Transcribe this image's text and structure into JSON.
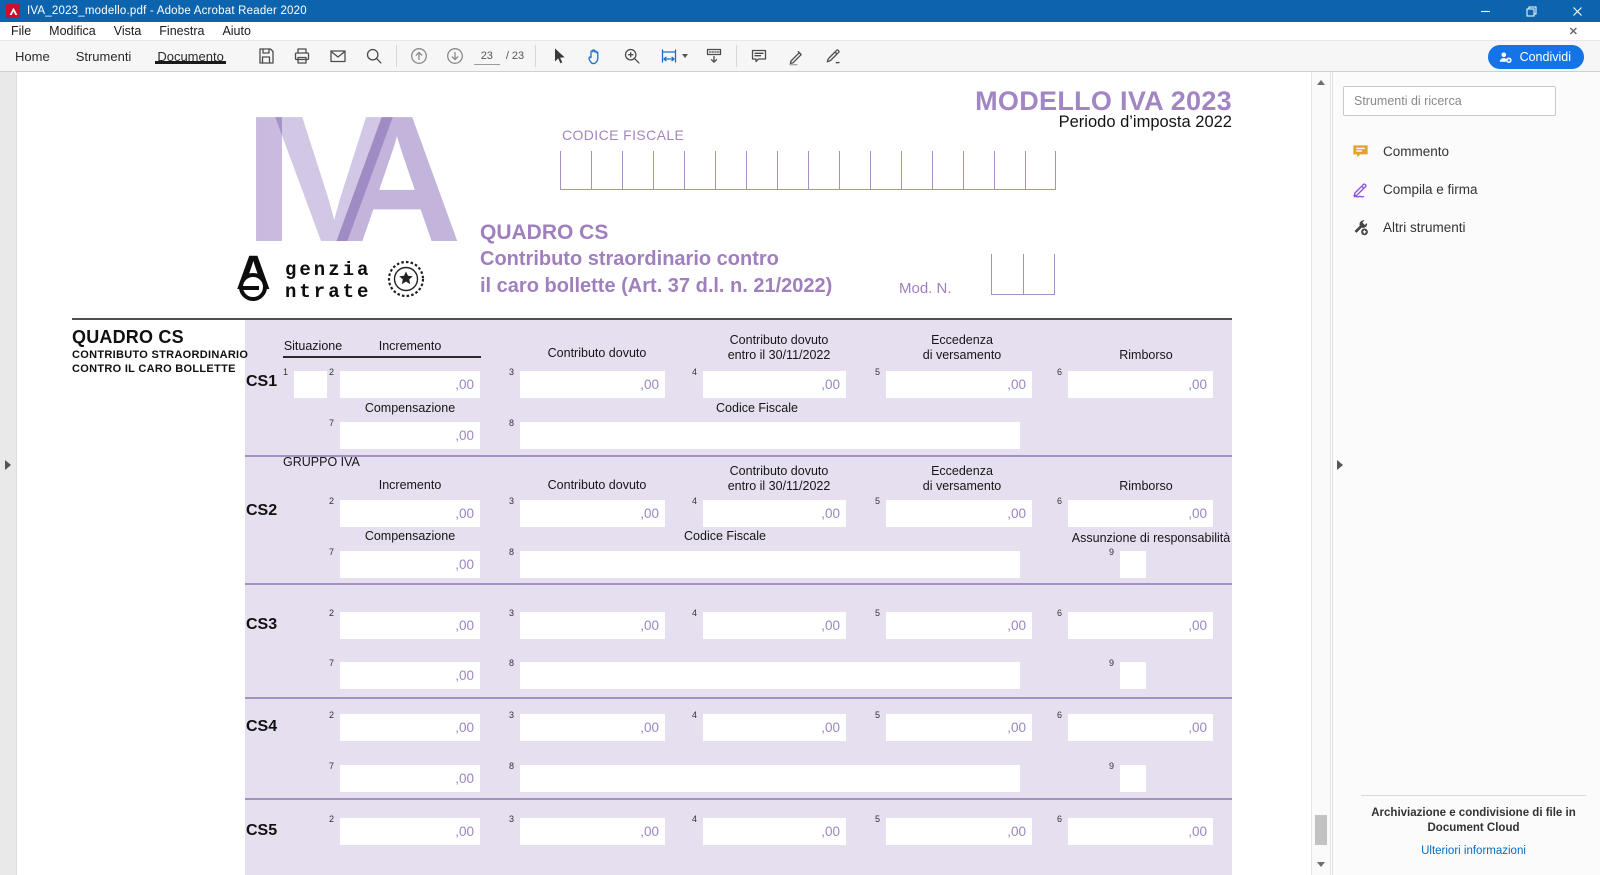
{
  "window": {
    "title": "IVA_2023_modello.pdf - Adobe Acrobat Reader 2020",
    "controls": {
      "minimize": "–",
      "restore": "restore",
      "close": "✕"
    }
  },
  "menu": {
    "items": [
      "File",
      "Modifica",
      "Vista",
      "Finestra",
      "Aiuto"
    ],
    "close_glyph": "✕"
  },
  "toolbar": {
    "tabs": [
      {
        "label": "Home"
      },
      {
        "label": "Strumenti"
      },
      {
        "label": "Documento"
      }
    ],
    "icons": [
      "save",
      "print",
      "email",
      "search",
      "page-up",
      "page-down",
      "select",
      "hand",
      "zoom-in",
      "fit-width",
      "page-display",
      "comment",
      "highlight",
      "fill-sign"
    ],
    "page": {
      "current": "23",
      "total": "/ 23"
    },
    "share_label": "Condividi"
  },
  "sidebar": {
    "search_placeholder": "Strumenti di ricerca",
    "tools": [
      {
        "label": "Commento",
        "icon": "comment-icon"
      },
      {
        "label": "Compila e firma",
        "icon": "fill-sign-icon"
      },
      {
        "label": "Altri strumenti",
        "icon": "more-tools-icon"
      }
    ],
    "footer": {
      "line1": "Archiviazione e condivisione di file in",
      "line2": "Document Cloud",
      "link": "Ulteriori informazioni"
    }
  },
  "pdf": {
    "header_title": "MODELLO IVA 2023",
    "header_subtitle": "Periodo d’imposta 2022",
    "logo": {
      "iva_i": "I",
      "iva_v": "V",
      "iva_a": "A",
      "big_a": "A",
      "line1": "genzia",
      "line2": "ntrate"
    },
    "codice_fiscale_label": "CODICE FISCALE",
    "codice_fiscale_cells": 16,
    "mod_cells": 2,
    "quadro_title": "QUADRO CS",
    "quadro_line1": "Contributo straordinario contro",
    "quadro_line2": "il caro bollette (Art. 37 d.l. n. 21/2022)",
    "mod_label": "Mod. N.",
    "margin_title": "QUADRO CS",
    "margin_sub1": "CONTRIBUTO STRAORDINARIO",
    "margin_sub2": "CONTRO IL CARO BOLLETTE",
    "form": {
      "labels": {
        "situazione": "Situazione",
        "incremento": "Incremento",
        "contributo_dovuto": "Contributo dovuto",
        "contributo_dovuto_2a": "Contributo dovuto",
        "contributo_dovuto_2b": "entro il 30/11/2022",
        "eccedenza_a": "Eccedenza",
        "eccedenza_b": "di versamento",
        "rimborso": "Rimborso",
        "compensazione": "Compensazione",
        "codice_fiscale": "Codice Fiscale",
        "gruppo_iva": "GRUPPO IVA",
        "assunzione": "Assunzione di responsabilità"
      },
      "amount_placeholder": ",00",
      "rows": [
        {
          "id": "CS1",
          "row1": [
            "1",
            "2",
            "3",
            "4",
            "5",
            "6"
          ],
          "row2": [
            "7",
            "8"
          ]
        },
        {
          "id": "CS2",
          "row1": [
            "2",
            "3",
            "4",
            "5",
            "6"
          ],
          "row2": [
            "7",
            "8",
            "9"
          ]
        },
        {
          "id": "CS3",
          "row1": [
            "2",
            "3",
            "4",
            "5",
            "6"
          ],
          "row2": [
            "7",
            "8",
            "9"
          ]
        },
        {
          "id": "CS4",
          "row1": [
            "2",
            "3",
            "4",
            "5",
            "6"
          ],
          "row2": [
            "7",
            "8",
            "9"
          ]
        },
        {
          "id": "CS5",
          "row1": [
            "2",
            "3",
            "4",
            "5",
            "6"
          ]
        }
      ]
    },
    "colors": {
      "accent_purple": "#9f7fbe",
      "band_purple": "#e5dff0",
      "title_purple": "#a285c3"
    }
  }
}
